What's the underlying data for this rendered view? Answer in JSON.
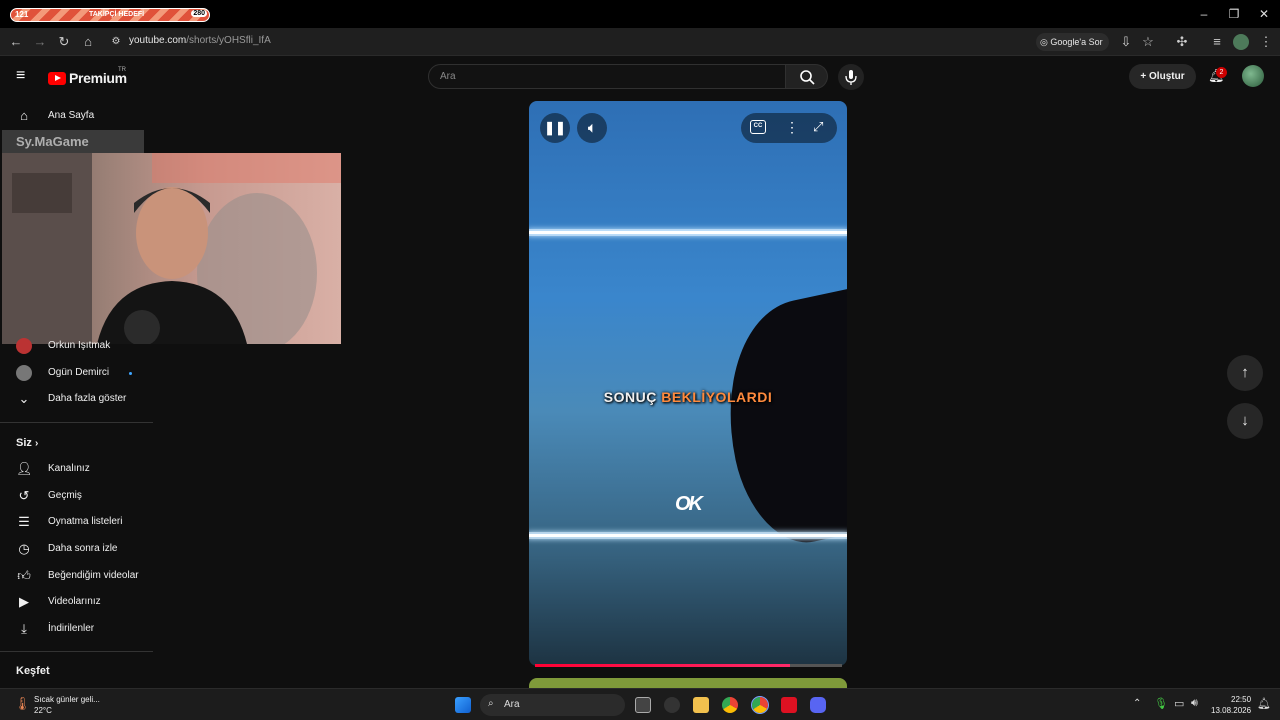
{
  "browser": {
    "tab": {
      "count_left": "121",
      "label": "TAKİPÇİ HEDEFİ",
      "count_right": "280"
    },
    "url_host": "youtube.com",
    "url_path": "/shorts/yOHSfli_IfA",
    "google_sor": "Google'a Sor"
  },
  "youtube": {
    "logo_text": "Premium",
    "logo_region": "TR",
    "search_placeholder": "Ara",
    "create_label": "Oluştur",
    "notification_count": "2"
  },
  "sidebar": {
    "home": "Ana Sayfa",
    "channels": [
      {
        "name": "Orkun Işıtmak"
      },
      {
        "name": "Ogün Demirci"
      }
    ],
    "show_more": "Daha fazla göster",
    "you_section": "Siz",
    "you_items": [
      {
        "label": "Kanalınız",
        "icon": "channel-icon"
      },
      {
        "label": "Geçmiş",
        "icon": "history-icon"
      },
      {
        "label": "Oynatma listeleri",
        "icon": "playlists-icon"
      },
      {
        "label": "Daha sonra izle",
        "icon": "watch-later-icon"
      },
      {
        "label": "Beğendiğim videolar",
        "icon": "like-icon"
      },
      {
        "label": "Videolarınız",
        "icon": "your-videos-icon"
      },
      {
        "label": "İndirilenler",
        "icon": "download-icon"
      }
    ],
    "explore_section": "Keşfet"
  },
  "overlay": {
    "game_label": "Sy.MaGame"
  },
  "video": {
    "caption_white": "SONUÇ",
    "caption_highlight": "BEKLİYOLARDI",
    "logo_text": "OK",
    "progress": 0.83
  },
  "taskbar": {
    "weather_text": "Sıcak günler geli...",
    "weather_temp": "22°C",
    "search_label": "Ara",
    "time": "22:50",
    "date": "13.08.2026"
  }
}
